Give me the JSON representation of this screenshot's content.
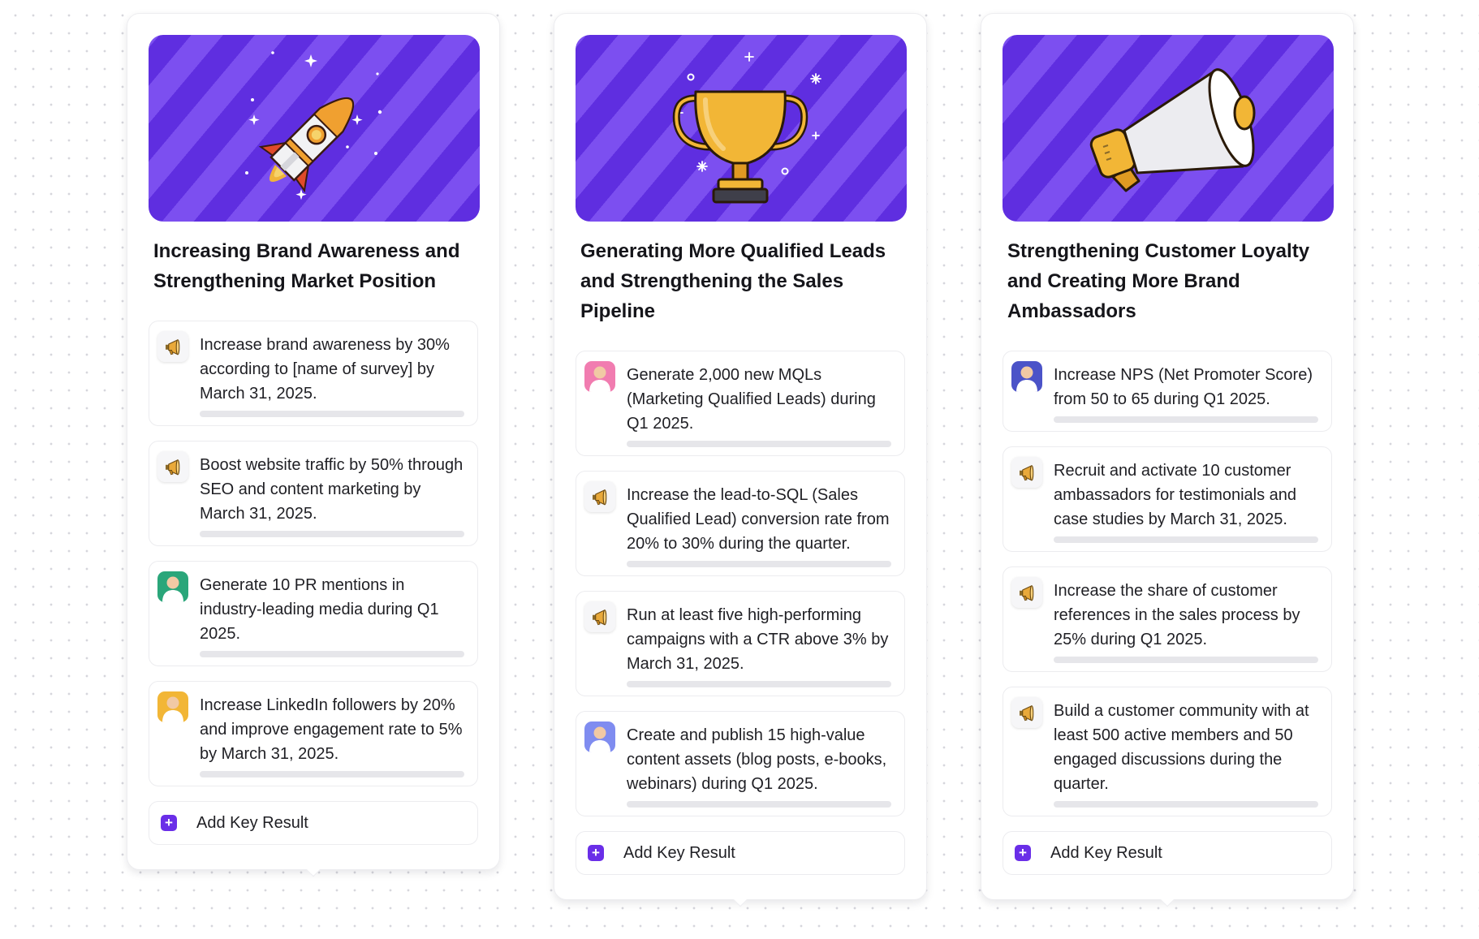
{
  "colors": {
    "accent": "#6a2ee8",
    "stripe_dark": "#5f2ee0",
    "stripe_light": "#7c4ff0",
    "progress_track": "#e6e6ea"
  },
  "add_label": "Add Key Result",
  "objectives": [
    {
      "title": "Increasing Brand Awareness and Strengthening Market Position",
      "hero_icon": "rocket-icon",
      "key_results": [
        {
          "icon": "megaphone-icon",
          "text": "Increase brand awareness by 30% according to [name of survey] by March 31, 2025.",
          "progress": 0
        },
        {
          "icon": "megaphone-icon",
          "text": "Boost website traffic by 50% through SEO and content marketing by March 31, 2025.",
          "progress": 0
        },
        {
          "icon": "avatar-man-green",
          "text": "Generate 10 PR mentions in industry-leading media during Q1 2025.",
          "progress": 0
        },
        {
          "icon": "avatar-woman-yellow",
          "text": "Increase LinkedIn followers by 20% and improve engagement rate to 5% by March 31, 2025.",
          "progress": 0
        }
      ]
    },
    {
      "title": "Generating More Qualified Leads and Strengthening the Sales Pipeline",
      "hero_icon": "trophy-icon",
      "key_results": [
        {
          "icon": "avatar-woman-pink",
          "text": "Generate 2,000 new MQLs (Marketing Qualified Leads) during Q1 2025.",
          "progress": 0
        },
        {
          "icon": "megaphone-icon",
          "text": "Increase the lead-to-SQL (Sales Qualified Lead) conversion rate from 20% to 30% during the quarter.",
          "progress": 0
        },
        {
          "icon": "megaphone-icon",
          "text": "Run at least five high-performing campaigns with a CTR above 3% by March 31, 2025.",
          "progress": 0
        },
        {
          "icon": "avatar-woman-blue",
          "text": "Create and publish 15 high-value content assets (blog posts, e-books, webinars) during Q1 2025.",
          "progress": 0
        }
      ]
    },
    {
      "title": "Strengthening Customer Loyalty and Creating More Brand Ambassadors",
      "hero_icon": "megaphone-icon",
      "key_results": [
        {
          "icon": "avatar-man-indigo",
          "text": "Increase NPS (Net Promoter Score) from 50 to 65 during Q1 2025.",
          "progress": 0
        },
        {
          "icon": "megaphone-icon",
          "text": "Recruit and activate 10 customer ambassadors for testimonials and case studies by March 31, 2025.",
          "progress": 0
        },
        {
          "icon": "megaphone-icon",
          "text": "Increase the share of customer references in the sales process by 25% during Q1 2025.",
          "progress": 0
        },
        {
          "icon": "megaphone-icon",
          "text": "Build a customer community with at least 500 active members and 50 engaged discussions during the quarter.",
          "progress": 0
        }
      ]
    }
  ]
}
